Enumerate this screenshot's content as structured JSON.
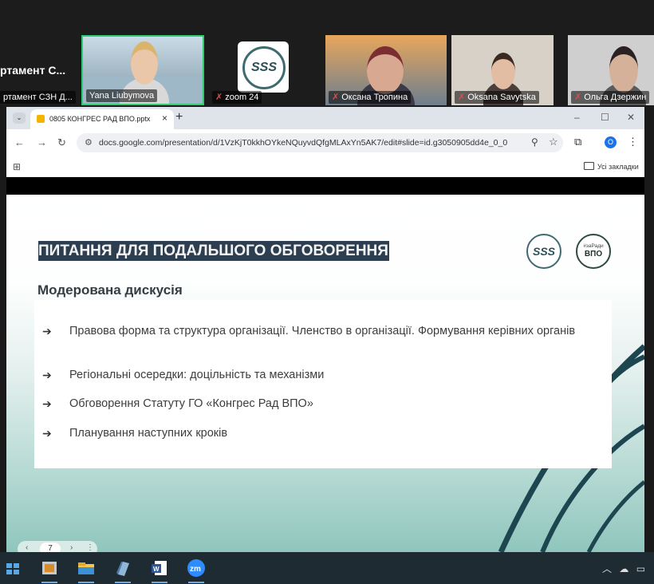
{
  "zoom": {
    "participants": [
      {
        "name": "ртамент СЗН Д...",
        "header": "ртамент С...",
        "muted": false
      },
      {
        "name": "Yana Liubymova",
        "muted": false
      },
      {
        "name": "zoom 24",
        "muted": true
      },
      {
        "name": "Оксана Тропина",
        "muted": true
      },
      {
        "name": "Oksana Savytska",
        "muted": true
      },
      {
        "name": "Ольга Дзержин",
        "muted": true
      }
    ]
  },
  "browser": {
    "tab_title": "0805 КОНГРЕС РАД ВПО.pptx",
    "tab_close": "×",
    "new_tab": "+",
    "dropdown": "⌄",
    "url": "docs.google.com/presentation/d/1VzKjT0kkhOYkeNQuyvdQfgMLAxYn5AK7/edit#slide=id.g3050905dd4e_0_0",
    "profile_initial": "O",
    "bookmarks_folder": "Усі закладки"
  },
  "slide": {
    "title": "ПИТАННЯ ДЛЯ ПОДАЛЬШОГО ОБГОВОРЕННЯ",
    "subtitle": "Модерована дискусія",
    "logo_sss": "SSS",
    "logo_vpo_small": "#заРади",
    "logo_vpo_big": "ВПО",
    "bullets": [
      "Правова форма та структура організації. Членство в організації. Формування керівних органів",
      "Регіональні осередки: доцільність та механізми",
      "Обговорення Статуту ГО «Конгрес Рад ВПО»",
      "Планування наступних кроків"
    ],
    "page": "7"
  },
  "taskbar": {
    "zoom_label": "zm"
  },
  "colors": {
    "title_bg": "#2c3e50",
    "curve": "#1e4650",
    "zoom_active_border": "#2ecc71",
    "muted_mic": "#e24b4b"
  }
}
